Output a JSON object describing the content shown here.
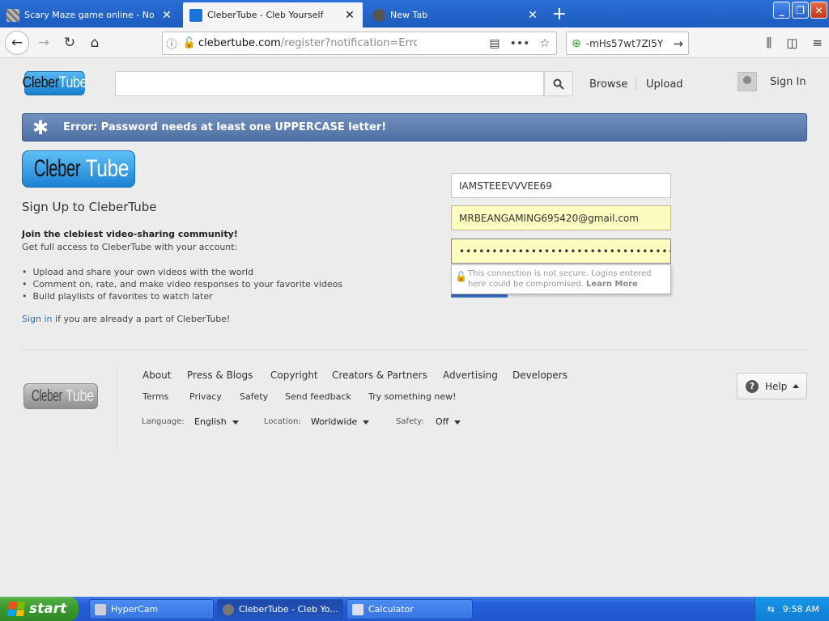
{
  "browser": {
    "tabs": [
      {
        "title": "Scary Maze game online - No overlays"
      },
      {
        "title": "CleberTube - Cleb Yourself"
      },
      {
        "title": "New Tab"
      }
    ],
    "active_tab": 1,
    "url_host": "clebertube.com",
    "url_path": "/register?notification=Error: Password needs at least one UPPERCASE letter!",
    "search_value": "-mHs57wt7ZI5Y"
  },
  "site": {
    "logo_left": "Cleber",
    "logo_right": "Tube",
    "nav": {
      "browse": "Browse",
      "upload": "Upload",
      "signin": "Sign In"
    },
    "error_message": "Error: Password needs at least one UPPERCASE letter!",
    "signup": {
      "title": "Sign Up to CleberTube",
      "tagline": "Join the clebiest video-sharing community!",
      "subtitle": "Get full access to CleberTube with your account:",
      "bullets": [
        "Upload and share your own videos with the world",
        "Comment on, rate, and make video responses to your favorite videos",
        "Build playlists of favorites to watch later"
      ],
      "signin_link": "Sign in",
      "signin_rest": " if you are already a part of CleberTube!"
    },
    "form": {
      "username": "IAMSTEEEVVVEE69",
      "email": "MRBEANGAMING695420@gmail.com",
      "password_dots": "••••••••••••••••••••••••••••••••••",
      "warning_text": "This connection is not secure. Logins entered here could be compromised.",
      "warning_link": "Learn More"
    },
    "footer": {
      "row1": [
        "About",
        "Press & Blogs",
        "Copyright",
        "Creators & Partners",
        "Advertising",
        "Developers"
      ],
      "row2": [
        "Terms",
        "Privacy",
        "Safety",
        "Send feedback",
        "Try something new!"
      ],
      "language_label": "Language:",
      "language_value": "English",
      "location_label": "Location:",
      "location_value": "Worldwide",
      "safety_label": "Safety:",
      "safety_value": "Off",
      "help": "Help"
    }
  },
  "taskbar": {
    "start": "start",
    "items": [
      "HyperCam",
      "CleberTube - Cleb Yo...",
      "Calculator"
    ],
    "clock": "9:58 AM"
  },
  "colors": {
    "error_bar": "#5a7ab0",
    "link": "#2a6bb8",
    "autofill": "#fcfbc0",
    "taskbar": "#245edb"
  }
}
